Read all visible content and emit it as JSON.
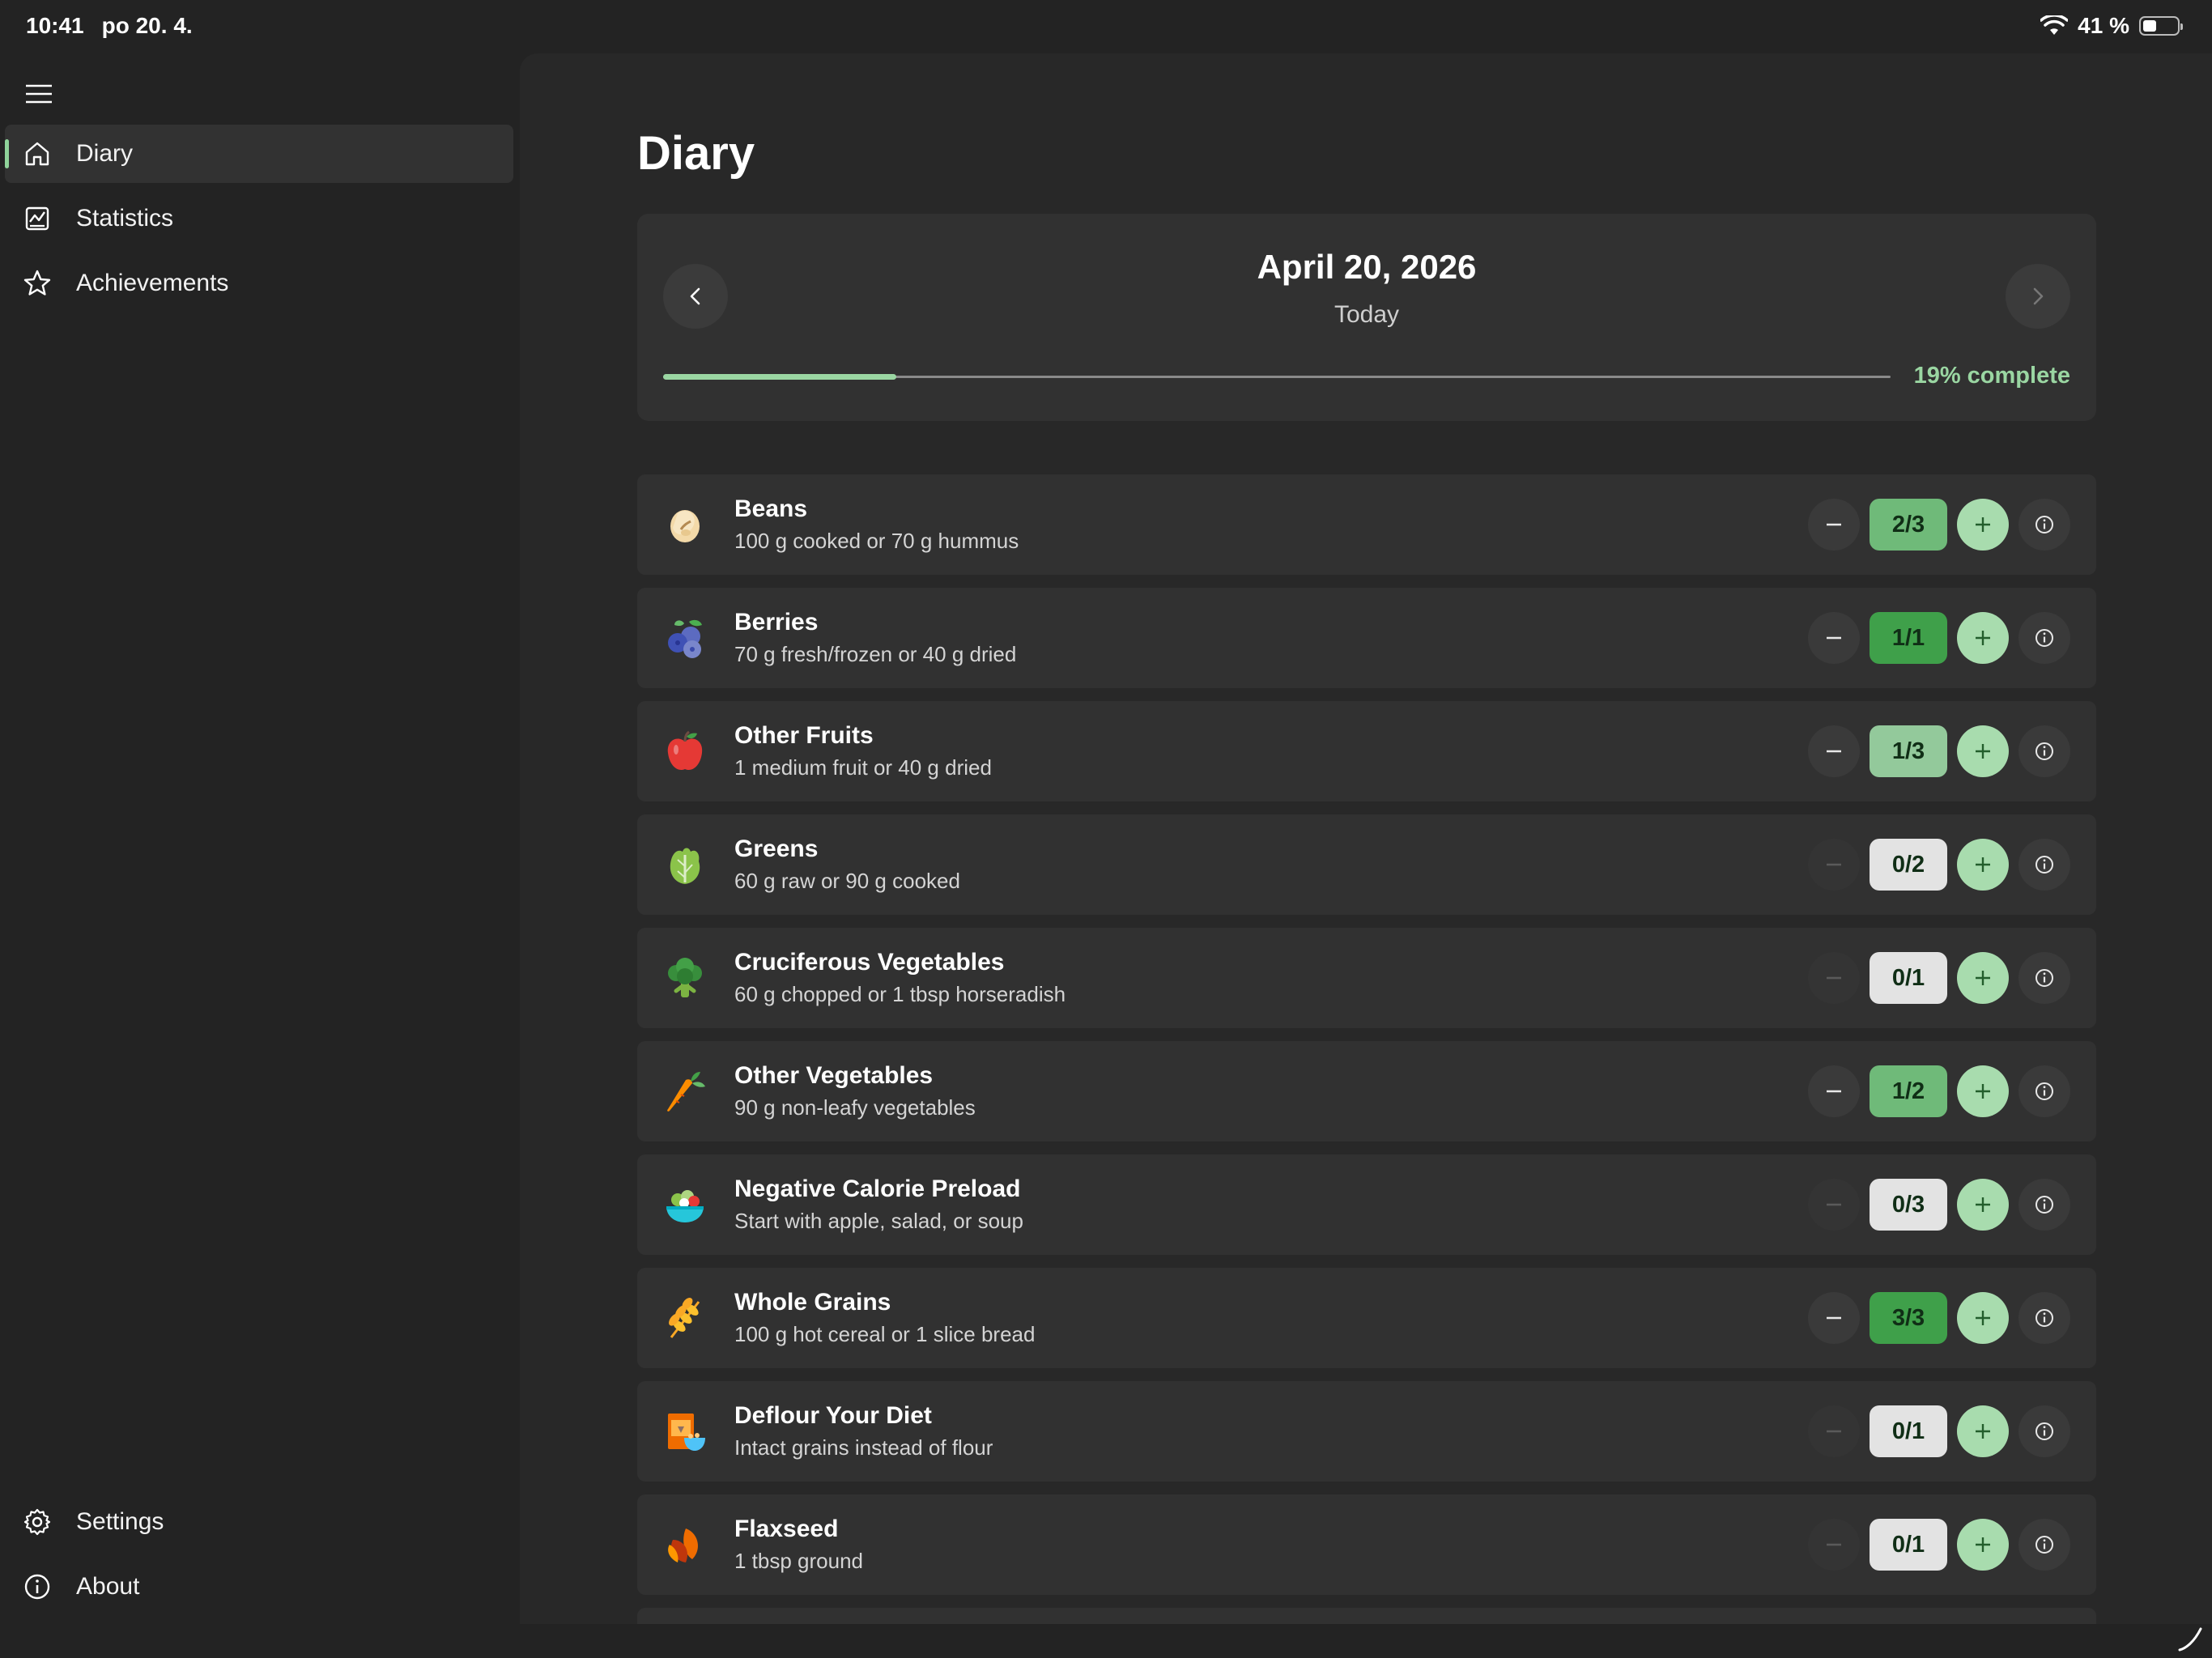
{
  "status_bar": {
    "time": "10:41",
    "date": "po 20. 4.",
    "battery": "41 %"
  },
  "sidebar": {
    "items": [
      {
        "label": "Diary",
        "icon": "home-icon",
        "active": true
      },
      {
        "label": "Statistics",
        "icon": "statistics-icon",
        "active": false
      },
      {
        "label": "Achievements",
        "icon": "star-icon",
        "active": false
      }
    ],
    "bottom_items": [
      {
        "label": "Settings",
        "icon": "gear-icon"
      },
      {
        "label": "About",
        "icon": "info-icon"
      }
    ]
  },
  "page": {
    "title": "Diary"
  },
  "date_card": {
    "date": "April 20, 2026",
    "relative": "Today",
    "progress_fraction": 0.19,
    "progress_label": "19% complete"
  },
  "colors": {
    "accent": "#9ad6a2",
    "count_full": "#3fa04a",
    "count_partial_high": "#6fba79",
    "count_partial_low": "#93c99b",
    "count_empty": "#e3e3e3"
  },
  "items": [
    {
      "name": "Beans",
      "desc": "100 g cooked or 70 g hummus",
      "count": "2/3",
      "icon": "bean-icon"
    },
    {
      "name": "Berries",
      "desc": "70 g fresh/frozen or 40 g dried",
      "count": "1/1",
      "icon": "blueberries-icon"
    },
    {
      "name": "Other Fruits",
      "desc": "1 medium fruit or 40 g dried",
      "count": "1/3",
      "icon": "apple-icon"
    },
    {
      "name": "Greens",
      "desc": "60 g raw or 90 g cooked",
      "count": "0/2",
      "icon": "lettuce-icon"
    },
    {
      "name": "Cruciferous Vegetables",
      "desc": "60 g chopped or 1 tbsp horseradish",
      "count": "0/1",
      "icon": "broccoli-icon"
    },
    {
      "name": "Other Vegetables",
      "desc": "90 g non-leafy vegetables",
      "count": "1/2",
      "icon": "carrot-icon"
    },
    {
      "name": "Negative Calorie Preload",
      "desc": "Start with apple, salad, or soup",
      "count": "0/3",
      "icon": "salad-bowl-icon"
    },
    {
      "name": "Whole Grains",
      "desc": "100 g hot cereal or 1 slice bread",
      "count": "3/3",
      "icon": "wheat-icon"
    },
    {
      "name": "Deflour Your Diet",
      "desc": "Intact grains instead of flour",
      "count": "0/1",
      "icon": "cereal-box-icon"
    },
    {
      "name": "Flaxseed",
      "desc": "1 tbsp ground",
      "count": "0/1",
      "icon": "flaxseed-icon"
    }
  ]
}
